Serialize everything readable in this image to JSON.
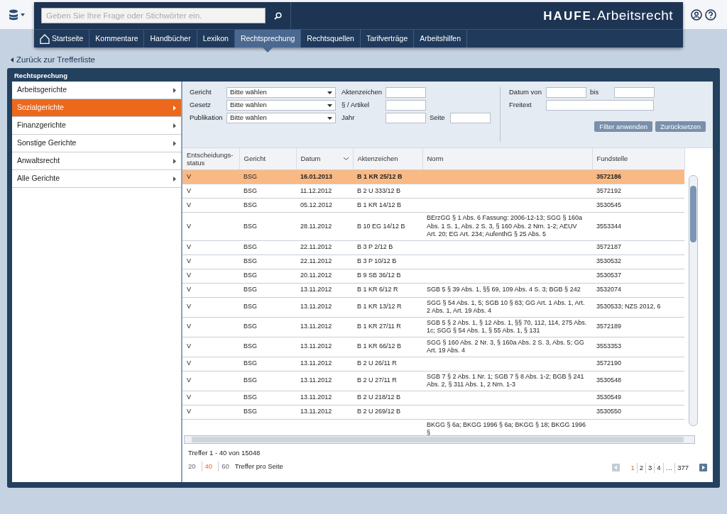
{
  "header": {
    "search_placeholder": "Geben Sie Ihre Frage oder Stichwörter ein.",
    "logo_brand": "HAUFE.",
    "logo_product": "Arbeitsrecht",
    "nav": [
      {
        "label": "Startseite",
        "kind": "home",
        "selected": false
      },
      {
        "label": "Kommentare",
        "selected": false
      },
      {
        "label": "Handbücher",
        "selected": false
      },
      {
        "label": "Lexikon",
        "selected": false
      },
      {
        "label": "Rechtsprechung",
        "selected": true
      },
      {
        "label": "Rechtsquellen",
        "selected": false
      },
      {
        "label": "Tarifverträge",
        "selected": false
      },
      {
        "label": "Arbeitshilfen",
        "selected": false
      }
    ]
  },
  "back_link": "Zurück zur Trefferliste",
  "panel_title": "Rechtsprechung",
  "sidebar": {
    "items": [
      {
        "label": "Arbeitsgerichte",
        "selected": false
      },
      {
        "label": "Sozialgerichte",
        "selected": true
      },
      {
        "label": "Finanzgerichte",
        "selected": false
      },
      {
        "label": "Sonstige Gerichte",
        "selected": false
      },
      {
        "label": "Anwaltsrecht",
        "selected": false
      },
      {
        "label": "Alle Gerichte",
        "selected": false
      }
    ]
  },
  "filters": {
    "rows": [
      [
        {
          "label": "Gericht",
          "kind": "select",
          "value": "Bitte wählen"
        },
        {
          "label": "Aktenzeichen",
          "kind": "input"
        }
      ],
      [
        {
          "label": "Gesetz",
          "kind": "select",
          "value": "Bitte wählen"
        },
        {
          "label": "§ / Artikel",
          "kind": "input"
        }
      ],
      [
        {
          "label": "Publikation",
          "kind": "select",
          "value": "Bitte wählen"
        },
        {
          "label": "Jahr",
          "kind": "input"
        },
        {
          "label": "Seite",
          "kind": "input"
        }
      ]
    ],
    "right_rows": [
      [
        {
          "label": "Datum von",
          "kind": "input"
        },
        {
          "label": "bis",
          "kind": "input"
        }
      ],
      [
        {
          "label": "Freitext",
          "kind": "wide"
        }
      ]
    ],
    "buttons": [
      "Filter anwenden",
      "Zurücksetzen"
    ]
  },
  "table": {
    "columns": [
      {
        "label": "Entscheidungs-status",
        "sorted": false
      },
      {
        "label": "Gericht",
        "sorted": false
      },
      {
        "label": "Datum",
        "sorted": true
      },
      {
        "label": "Aktenzeichen",
        "sorted": false
      },
      {
        "label": "Norm",
        "sorted": false
      },
      {
        "label": "Fundstelle",
        "sorted": false
      }
    ],
    "rows": [
      {
        "selected": true,
        "status": "V",
        "court": "BSG",
        "date": "16.01.2013",
        "file_no": "B 1 KR 25/12 B",
        "source": "3572186"
      },
      {
        "selected": false,
        "status": "V",
        "court": "BSG",
        "date": "11.12.2012",
        "file_no": "B 2 U 333/12 B",
        "source": "3572192"
      },
      {
        "selected": false,
        "status": "V",
        "court": "BSG",
        "date": "05.12.2012",
        "file_no": "B 1 KR 14/12 B",
        "source": "3530545"
      },
      {
        "selected": false,
        "status": "V",
        "court": "BSG",
        "date": "28.11.2012",
        "file_no": "B 10 EG 14/12 B",
        "norm": "BErzGG § 1 Abs. 6 Fassung: 2006-12-13; SGG § 160a Abs. 1 S. 1, Abs. 2 S. 3, § 160 Abs. 2 Nrn. 1-2; AEUV Art. 20; EG Art. 234; AufenthG § 25 Abs. 5",
        "source": "3553344"
      },
      {
        "selected": false,
        "status": "V",
        "court": "BSG",
        "date": "22.11.2012",
        "file_no": "B 3 P 2/12 B",
        "source": "3572187"
      },
      {
        "selected": false,
        "status": "V",
        "court": "BSG",
        "date": "22.11.2012",
        "file_no": "B 3 P 10/12 B",
        "source": "3530532"
      },
      {
        "selected": false,
        "status": "V",
        "court": "BSG",
        "date": "20.11.2012",
        "file_no": "B 9 SB 36/12 B",
        "source": "3530537"
      },
      {
        "selected": false,
        "status": "V",
        "court": "BSG",
        "date": "13.11.2012",
        "file_no": "B 1 KR 6/12 R",
        "norm": "SGB 5 § 39 Abs. 1, §§ 69, 109 Abs. 4 S. 3; BGB § 242",
        "source": "3532074"
      },
      {
        "selected": false,
        "status": "V",
        "court": "BSG",
        "date": "13.11.2012",
        "file_no": "B 1 KR 13/12 R",
        "norm": "SGG § 54 Abs. 1, 5; SGB 10 § 83; GG Art. 1 Abs. 1, Art. 2 Abs. 1, Art. 19 Abs. 4",
        "source": "3530533; NZS 2012, 6"
      },
      {
        "selected": false,
        "status": "V",
        "court": "BSG",
        "date": "13.11.2012",
        "file_no": "B 1 KR 27/11 R",
        "norm": "SGB 5 § 2 Abs. 1, § 12 Abs. 1, §§ 70, 112, 114, 275 Abs. 1c; SGG § 54 Abs. 1, § 55 Abs. 1, § 131",
        "source": "3572189"
      },
      {
        "selected": false,
        "status": "V",
        "court": "BSG",
        "date": "13.11.2012",
        "file_no": "B 1 KR 66/12 B",
        "norm": "SGG § 160 Abs. 2 Nr. 3, § 160a Abs. 2 S. 3, Abs. 5; GG Art. 19 Abs. 4",
        "source": "3553353"
      },
      {
        "selected": false,
        "status": "V",
        "court": "BSG",
        "date": "13.11.2012",
        "file_no": "B 2 U 26/11 R",
        "source": "3572190"
      },
      {
        "selected": false,
        "status": "V",
        "court": "BSG",
        "date": "13.11.2012",
        "file_no": "B 2 U 27/11 R",
        "norm": "SGB 7 § 2 Abs. 1 Nr. 1; SGB 7 § 8 Abs. 1-2; BGB § 241 Abs. 2, § 311 Abs. 1, 2 Nrn. 1-3",
        "source": "3530548"
      },
      {
        "selected": false,
        "status": "V",
        "court": "BSG",
        "date": "13.11.2012",
        "file_no": "B 2 U 218/12 B",
        "source": "3530549"
      },
      {
        "selected": false,
        "status": "V",
        "court": "BSG",
        "date": "13.11.2012",
        "file_no": "B 2 U 269/12 B",
        "source": "3530550"
      },
      {
        "selected": false,
        "norm": "BKGG § 6a; BKGG 1996 § 6a; BKGG § 18; BKGG 1996 §"
      }
    ]
  },
  "footer": {
    "summary": "Treffer 1 - 40 von 15048",
    "page_sizes": [
      {
        "label": "20",
        "selected": false
      },
      {
        "label": "40",
        "selected": true
      },
      {
        "label": "60",
        "selected": false
      }
    ],
    "page_size_label": "Treffer pro Seite",
    "pages": [
      {
        "label": "1",
        "selected": true
      },
      {
        "label": "2",
        "selected": false
      },
      {
        "label": "3",
        "selected": false
      },
      {
        "label": "4",
        "selected": false
      },
      {
        "label": "…",
        "selected": false
      },
      {
        "label": "377",
        "selected": false
      }
    ]
  }
}
